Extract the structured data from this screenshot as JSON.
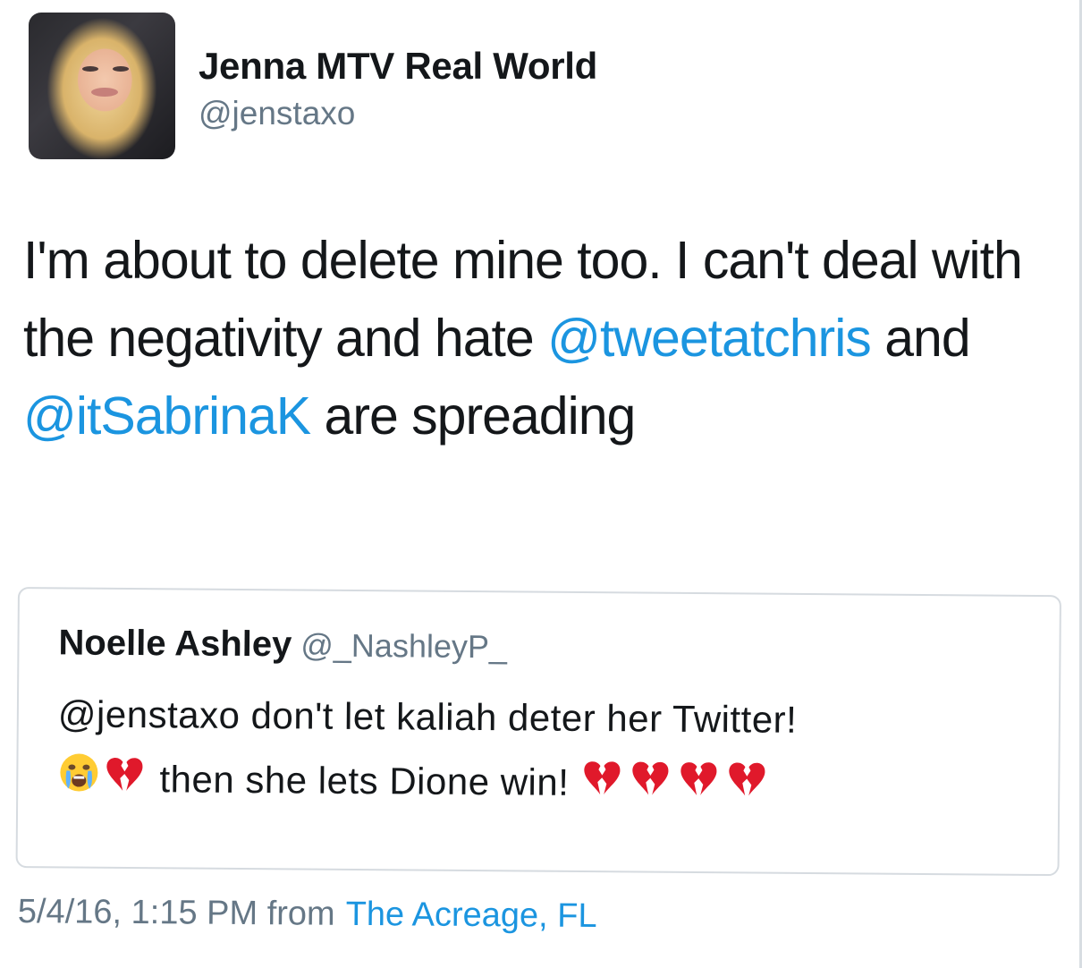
{
  "author": {
    "name": "Jenna MTV Real World",
    "handle": "@jenstaxo"
  },
  "tweet": {
    "line1": "I'm about to delete mine too. I can't deal with the negativity and hate",
    "mention1": "@tweetatchris",
    "and": "and",
    "mention2": "@itSabrinaK",
    "tail": "are spreading"
  },
  "quoted": {
    "name": "Noelle Ashley",
    "handle": "@_NashleyP_",
    "line1": "@jenstaxo don't let kaliah deter her Twitter!",
    "line2": "then she lets Dione win!",
    "emoji_icons": [
      "crying-face-icon",
      "broken-heart-icon",
      "broken-heart-icon",
      "broken-heart-icon",
      "broken-heart-icon",
      "broken-heart-icon"
    ]
  },
  "meta": {
    "timestamp": "5/4/16, 1:15 PM from",
    "location": "The Acreage, FL"
  },
  "colors": {
    "link": "#1b95e0",
    "secondary_text": "#657786",
    "border": "#d6dbe0"
  }
}
